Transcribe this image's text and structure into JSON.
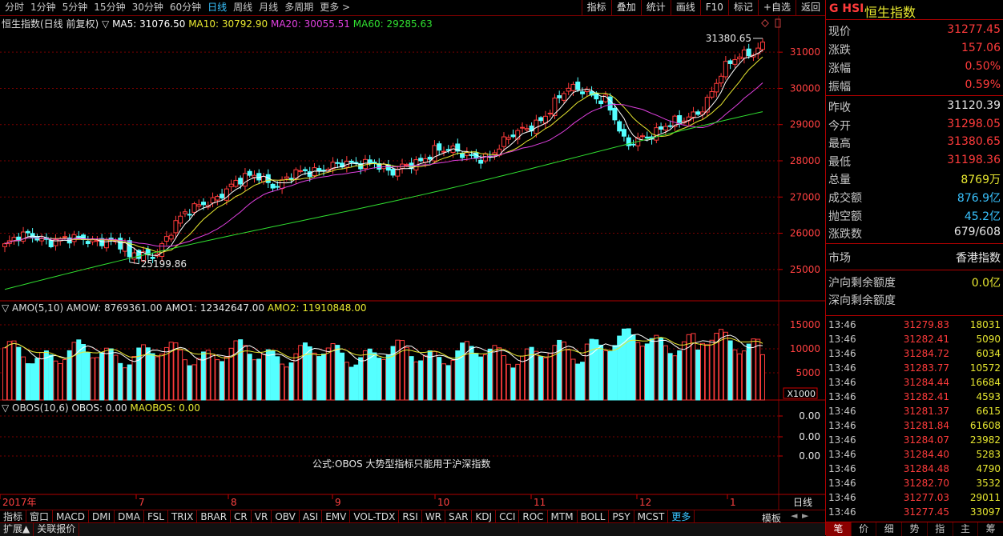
{
  "periods": [
    "分时",
    "1分钟",
    "5分钟",
    "15分钟",
    "30分钟",
    "60分钟",
    "日线",
    "周线",
    "月线",
    "多周期",
    "更多 >"
  ],
  "active_period": "日线",
  "tools": [
    "指标",
    "叠加",
    "统计",
    "画线",
    "F10",
    "标记",
    "+自选",
    "返回"
  ],
  "main_legend": {
    "title": "恒生指数(日线 前复权) ▽",
    "ma5": "MA5: 31076.50",
    "ma10": "MA10: 30792.90",
    "ma20": "MA20: 30055.51",
    "ma60": "MA60: 29285.63"
  },
  "colors": {
    "ma5": "#ffffff",
    "ma10": "#e8e830",
    "ma20": "#e040e0",
    "ma60": "#30e030",
    "up": "#ff3b3b",
    "down": "#54ffff",
    "grid": "#7a0000"
  },
  "price_axis": [
    "31000",
    "30000",
    "29000",
    "28000",
    "27000",
    "26000",
    "25000"
  ],
  "high_label": "31380.65",
  "low_label": "25199.86",
  "amo_legend": {
    "title": "▽ AMO(5,10)",
    "amow": "AMOW: 8769361.00",
    "amo1": "AMO1: 12342647.00",
    "amo2": "AMO2: 11910848.00"
  },
  "amo_axis": [
    "15000",
    "10000",
    "5000"
  ],
  "amo_unit": "X1000",
  "obos_legend": {
    "title": "▽ OBOS(10,6)",
    "obos": "OBOS: 0.00",
    "maobos": "MAOBOS: 0.00"
  },
  "obos_axis": [
    "0.00",
    "0.00",
    "0.00"
  ],
  "obos_note": "公式:OBOS 大势型指标只能用于沪深指数",
  "date_axis": [
    "2017年",
    "7",
    "8",
    "9",
    "10",
    "11",
    "12",
    "1"
  ],
  "date_axis_right": "日线",
  "indicator_tabs": [
    "指标",
    "窗口",
    "MACD",
    "DMI",
    "DMA",
    "FSL",
    "TRIX",
    "BRAR",
    "CR",
    "VR",
    "OBV",
    "ASI",
    "EMV",
    "VOL-TDX",
    "RSI",
    "WR",
    "SAR",
    "KDJ",
    "CCI",
    "ROC",
    "MTM",
    "BOLL",
    "PSY",
    "MCST",
    "更多"
  ],
  "template_label": "模板",
  "bottom_links": [
    "扩展▲",
    "关联报价"
  ],
  "quote": {
    "code": "G HSI",
    "name": "恒生指数",
    "rows": [
      {
        "k": "现价",
        "v": "31277.45",
        "c": "#ff3b3b"
      },
      {
        "k": "涨跌",
        "v": "157.06",
        "c": "#ff3b3b"
      },
      {
        "k": "涨幅",
        "v": "0.50%",
        "c": "#ff3b3b"
      },
      {
        "k": "振幅",
        "v": "0.59%",
        "c": "#ff3b3b"
      }
    ],
    "rows2": [
      {
        "k": "昨收",
        "v": "31120.39",
        "c": "#e8e8e8"
      },
      {
        "k": "今开",
        "v": "31298.05",
        "c": "#ff3b3b"
      },
      {
        "k": "最高",
        "v": "31380.65",
        "c": "#ff3b3b"
      },
      {
        "k": "最低",
        "v": "31198.36",
        "c": "#ff3b3b"
      },
      {
        "k": "总量",
        "v": "8769万",
        "c": "#e8e830"
      },
      {
        "k": "成交额",
        "v": "876.9亿",
        "c": "#39c3ff"
      },
      {
        "k": "抛空额",
        "v": "45.2亿",
        "c": "#39c3ff"
      },
      {
        "k": "涨跌数",
        "v": "679/608",
        "c": "#e8e8e8"
      }
    ],
    "market_label": "市场",
    "market_value": "香港指数",
    "north_label": "沪向剩余额度",
    "north_value": "0.0亿",
    "south_label": "深向剩余额度"
  },
  "ticks": [
    {
      "t": "13:46",
      "p": "31279.83",
      "v": "18031"
    },
    {
      "t": "13:46",
      "p": "31282.41",
      "v": "5090"
    },
    {
      "t": "13:46",
      "p": "31284.72",
      "v": "6034"
    },
    {
      "t": "13:46",
      "p": "31283.77",
      "v": "10572"
    },
    {
      "t": "13:46",
      "p": "31284.44",
      "v": "16684"
    },
    {
      "t": "13:46",
      "p": "31282.41",
      "v": "4593"
    },
    {
      "t": "13:46",
      "p": "31281.37",
      "v": "6615"
    },
    {
      "t": "13:46",
      "p": "31281.84",
      "v": "61608"
    },
    {
      "t": "13:46",
      "p": "31284.07",
      "v": "23982"
    },
    {
      "t": "13:46",
      "p": "31284.40",
      "v": "5283"
    },
    {
      "t": "13:46",
      "p": "31284.48",
      "v": "4790"
    },
    {
      "t": "13:46",
      "p": "31282.70",
      "v": "3532"
    },
    {
      "t": "13:46",
      "p": "31277.03",
      "v": "29011"
    },
    {
      "t": "13:46",
      "p": "31277.45",
      "v": "33097"
    }
  ],
  "rp_tabs": [
    "笔",
    "价",
    "细",
    "势",
    "指",
    "主",
    "筹"
  ],
  "rp_active_tab": "笔",
  "chart_data": {
    "type": "candlestick",
    "ylim": [
      24400,
      31600
    ],
    "x_labels": [
      "2017年",
      "7",
      "8",
      "9",
      "10",
      "11",
      "12",
      "1"
    ],
    "key_points": [
      {
        "label": "start",
        "close": 25700
      },
      {
        "label": "low",
        "close": 25199.86
      },
      {
        "label": "Aug",
        "close": 27600
      },
      {
        "label": "Oct",
        "close": 28300
      },
      {
        "label": "Nov peak",
        "close": 29900
      },
      {
        "label": "Dec dip",
        "close": 28400
      },
      {
        "label": "high",
        "close": 31380.65
      }
    ]
  }
}
